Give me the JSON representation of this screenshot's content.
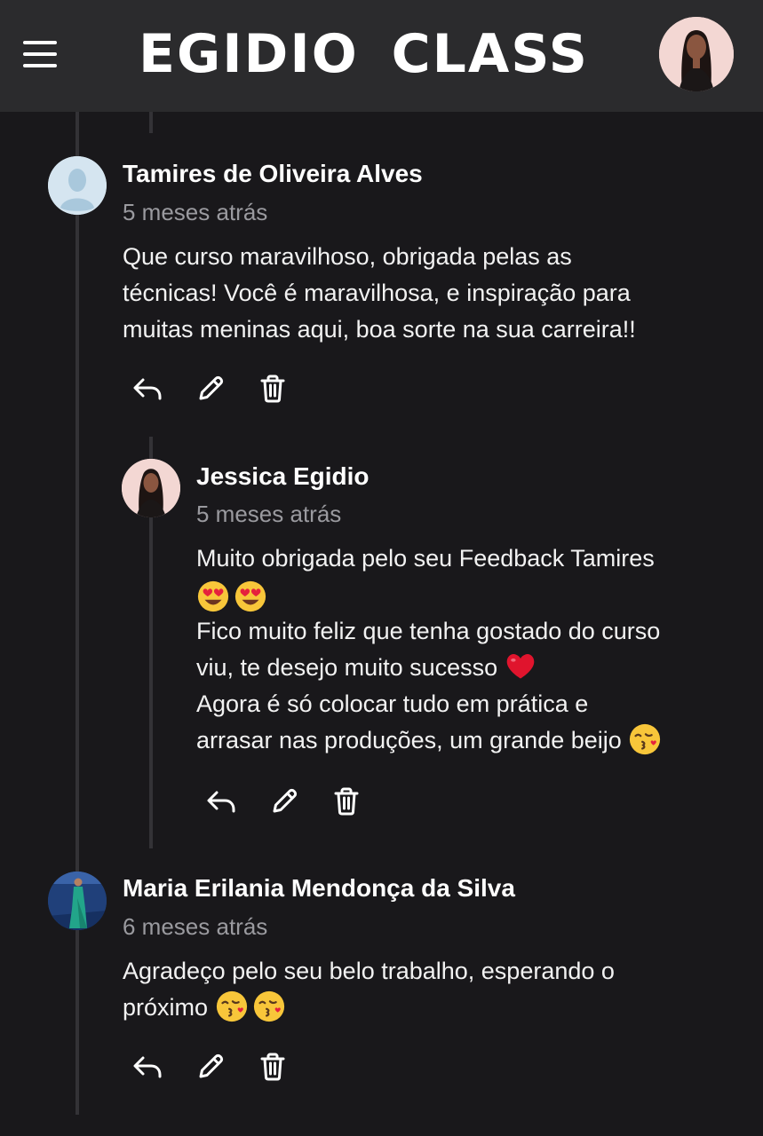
{
  "header": {
    "menu_icon": "hamburger-menu-icon",
    "brand": "EGIDIO  CLASS",
    "avatar_icon": "user-avatar"
  },
  "comments": [
    {
      "author": "Tamires de Oliveira Alves",
      "time": "5 meses atrás",
      "lines": [
        "Que curso maravilhoso, obrigada pelas as",
        "técnicas! Você é maravilhosa, e inspiração para",
        "muitas meninas aqui, boa sorte na sua carreira!!"
      ],
      "actions": {
        "reply": "reply-icon",
        "edit": "edit-pencil-icon",
        "delete": "trash-icon"
      }
    },
    {
      "author": "Jessica Egidio",
      "time": "5 meses atrás",
      "lines": [
        "Muito obrigada pelo seu Feedback Tamires",
        "",
        "Fico muito feliz que tenha gostado do curso",
        "viu, te desejo muito sucesso",
        "Agora é só colocar tudo em prática e",
        "arrasar nas produções, um grande beijo"
      ],
      "emojis": [
        "heart-eyes-emoji",
        "heart-eyes-emoji",
        "red-heart-emoji",
        "kiss-emoji"
      ],
      "actions": {
        "reply": "reply-icon",
        "edit": "edit-pencil-icon",
        "delete": "trash-icon"
      }
    },
    {
      "author": "Maria Erilania Mendonça da Silva",
      "time": "6 meses atrás",
      "lines": [
        "Agradeço pelo seu belo trabalho, esperando o",
        "próximo"
      ],
      "emojis": [
        "kiss-emoji",
        "kiss-emoji"
      ],
      "actions": {
        "reply": "reply-icon",
        "edit": "edit-pencil-icon",
        "delete": "trash-icon"
      }
    }
  ],
  "colors": {
    "background": "#19181b",
    "header": "#2b2b2d",
    "thread_line": "#333236",
    "timestamp": "#9a9a9f"
  }
}
